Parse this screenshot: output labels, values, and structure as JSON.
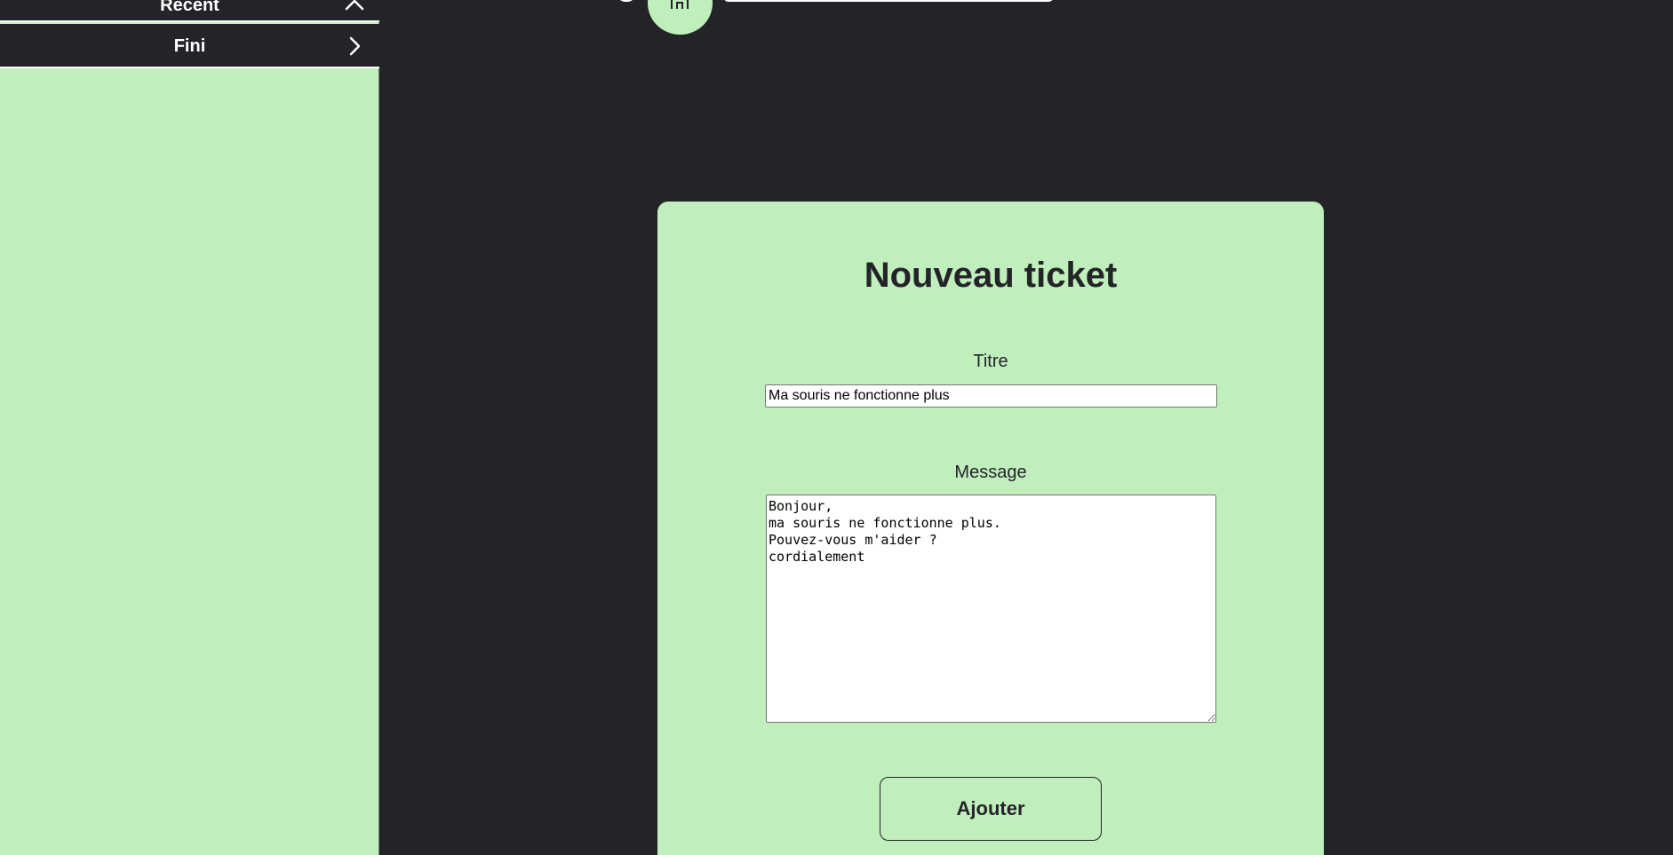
{
  "sidebar": {
    "items": [
      {
        "label": "Recent",
        "icon": "chevron-up-icon"
      },
      {
        "label": "Fini",
        "icon": "chevron-right-icon"
      }
    ]
  },
  "header": {
    "home_icon": "home-icon"
  },
  "form": {
    "title": "Nouveau ticket",
    "title_label": "Titre",
    "title_value": "Ma souris ne fonctionne plus",
    "message_label": "Message",
    "message_value": "Bonjour,\nma souris ne fonctionne plus.\nPouvez-vous m'aider ?\ncordialement",
    "submit_label": "Ajouter"
  },
  "colors": {
    "background": "#232428",
    "accent": "#c1eebd",
    "text": "#232428"
  }
}
